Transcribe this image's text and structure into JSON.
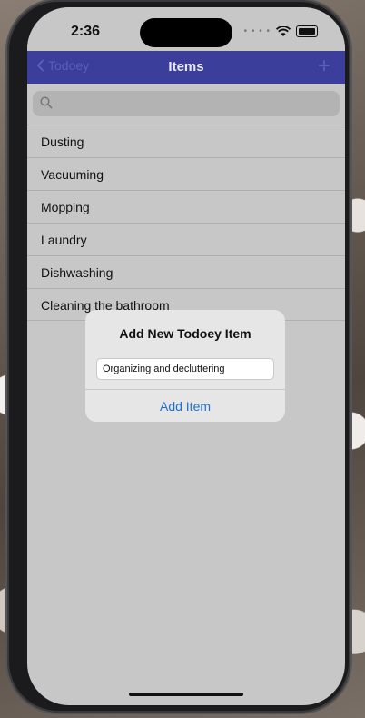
{
  "status_bar": {
    "time": "2:36"
  },
  "nav": {
    "back_label": "Todoey",
    "title": "Items"
  },
  "search": {
    "placeholder": ""
  },
  "items": [
    {
      "label": "Dusting"
    },
    {
      "label": "Vacuuming"
    },
    {
      "label": "Mopping"
    },
    {
      "label": "Laundry"
    },
    {
      "label": "Dishwashing"
    },
    {
      "label": "Cleaning the bathroom"
    }
  ],
  "dialog": {
    "title": "Add New Todoey Item",
    "input_value": "Organizing and decluttering",
    "action_label": "Add Item"
  },
  "colors": {
    "nav_background": "#3b3f9b",
    "accent_link": "#1f6fd1",
    "screen_background": "#c7c7c7"
  }
}
